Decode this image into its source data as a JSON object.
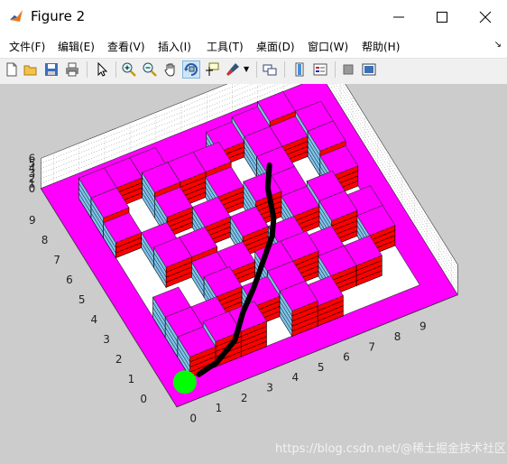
{
  "window": {
    "title": "Figure 2"
  },
  "menubar": {
    "items": [
      {
        "label": "文件(F)"
      },
      {
        "label": "编辑(E)"
      },
      {
        "label": "查看(V)"
      },
      {
        "label": "插入(I)"
      },
      {
        "label": "工具(T)"
      },
      {
        "label": "桌面(D)"
      },
      {
        "label": "窗口(W)"
      },
      {
        "label": "帮助(H)"
      }
    ]
  },
  "toolbar": {
    "tools": [
      "new-figure",
      "open-file",
      "save",
      "print",
      "select-arrow",
      "zoom-in",
      "zoom-out",
      "pan",
      "rotate-3d",
      "data-cursor",
      "brush",
      "link-plot",
      "insert-colorbar",
      "insert-legend",
      "hide-plot-tools",
      "show-plot-tools"
    ],
    "active": "rotate-3d"
  },
  "plot": {
    "x_ticks": [
      "0",
      "1",
      "2",
      "3",
      "4",
      "5",
      "6",
      "7",
      "8",
      "9"
    ],
    "y_ticks": [
      "0",
      "1",
      "2",
      "3",
      "4",
      "5",
      "6",
      "7",
      "8",
      "9"
    ],
    "z_ticks": [
      "0",
      "1",
      "2",
      "3",
      "4",
      "5",
      "6"
    ],
    "colors": {
      "border": "#ff00ff",
      "brick": "#ff0000",
      "brick_side": "#7ec3ec",
      "path": "#000000",
      "start": "#00ff00",
      "floor": "#ffffff",
      "background": "#cccccc"
    }
  },
  "watermark": "https://blog.csdn.net/@稀土掘金技术社区"
}
